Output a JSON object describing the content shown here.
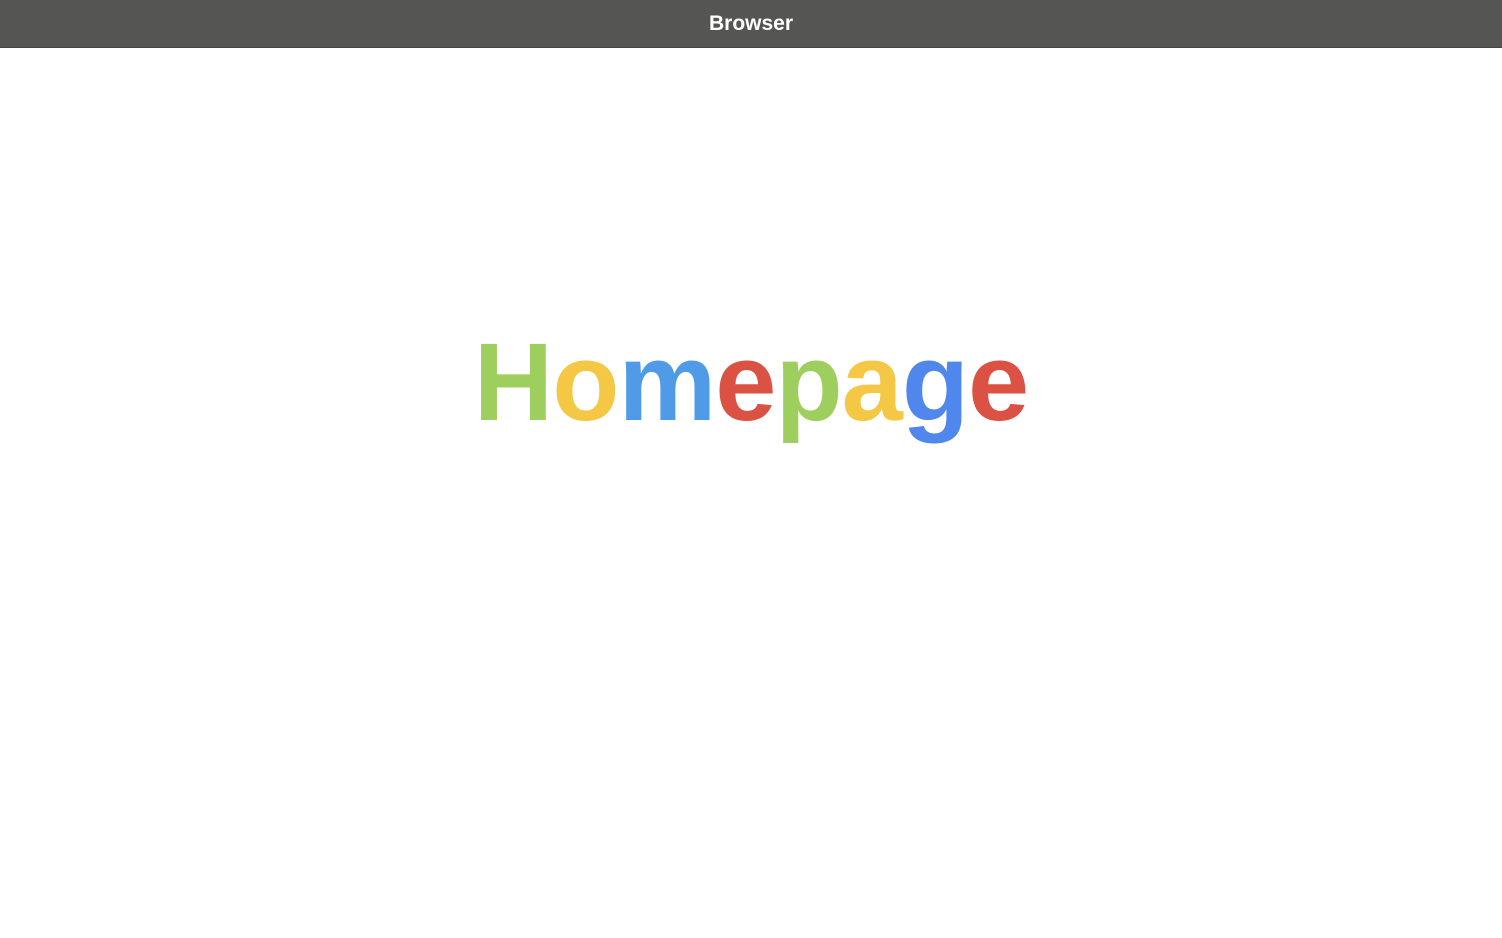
{
  "window": {
    "title": "Browser"
  },
  "logo": {
    "text": "Homepage",
    "letters": [
      {
        "char": "H",
        "color": "#9ECE5E"
      },
      {
        "char": "o",
        "color": "#F4C745"
      },
      {
        "char": "m",
        "color": "#4F9BE8"
      },
      {
        "char": "e",
        "color": "#DB5244"
      },
      {
        "char": "p",
        "color": "#9ECE5E"
      },
      {
        "char": "a",
        "color": "#F4C745"
      },
      {
        "char": "g",
        "color": "#4F87EC"
      },
      {
        "char": "e",
        "color": "#DB5244"
      }
    ]
  }
}
